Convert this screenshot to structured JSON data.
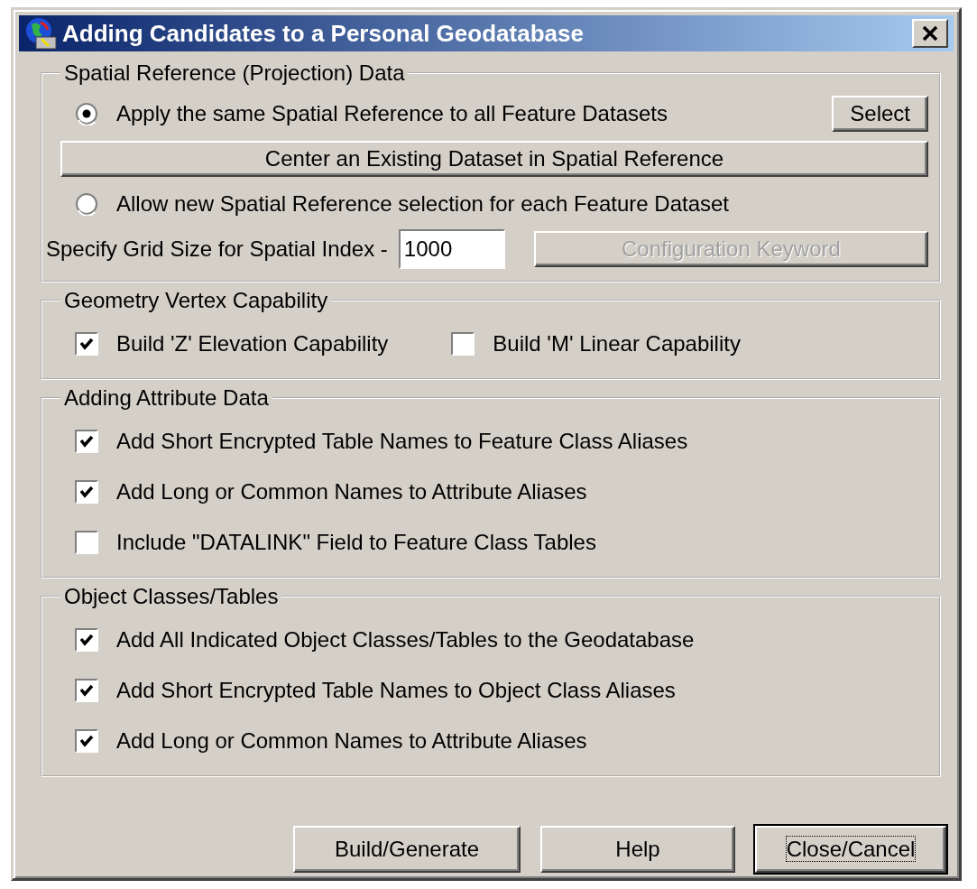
{
  "window": {
    "title": "Adding Candidates to a Personal Geodatabase"
  },
  "groups": [
    {
      "title": "Spatial Reference (Projection) Data",
      "inline": false,
      "items": [
        {
          "kind": "radio",
          "label": "Apply the same Spatial Reference to all Feature Datasets",
          "selected": true,
          "button": {
            "label": "Select",
            "disabled": false
          }
        },
        {
          "kind": "button",
          "label": "Center an Existing Dataset in Spatial Reference",
          "disabled": false
        },
        {
          "kind": "radio",
          "label": "Allow new Spatial Reference selection for each Feature Dataset",
          "selected": false
        },
        {
          "kind": "field",
          "label": "Specify Grid Size for Spatial Index -",
          "value": "1000",
          "button": {
            "label": "Configuration Keyword",
            "disabled": true
          }
        }
      ]
    },
    {
      "title": "Geometry Vertex Capability",
      "inline": true,
      "items": [
        {
          "kind": "checkbox",
          "label": "Build 'Z' Elevation Capability",
          "checked": true
        },
        {
          "kind": "checkbox",
          "label": "Build 'M' Linear Capability",
          "checked": false
        }
      ]
    },
    {
      "title": "Adding Attribute Data",
      "inline": false,
      "items": [
        {
          "kind": "checkbox",
          "label": "Add Short Encrypted Table Names to Feature Class Aliases",
          "checked": true
        },
        {
          "kind": "checkbox",
          "label": "Add Long or Common Names to Attribute Aliases",
          "checked": true
        },
        {
          "kind": "checkbox",
          "label": "Include \"DATALINK\" Field to Feature Class Tables",
          "checked": false
        }
      ]
    },
    {
      "title": "Object Classes/Tables",
      "inline": false,
      "items": [
        {
          "kind": "checkbox",
          "label": "Add All Indicated Object Classes/Tables to the Geodatabase",
          "checked": true
        },
        {
          "kind": "checkbox",
          "label": "Add Short Encrypted Table Names to Object Class Aliases",
          "checked": true
        },
        {
          "kind": "checkbox",
          "label": "Add Long or Common Names to Attribute Aliases",
          "checked": true
        }
      ]
    }
  ],
  "buttons": [
    {
      "label": "Build/Generate",
      "focused": false
    },
    {
      "label": "Help",
      "focused": false
    },
    {
      "label": "Close/Cancel",
      "focused": true
    }
  ]
}
